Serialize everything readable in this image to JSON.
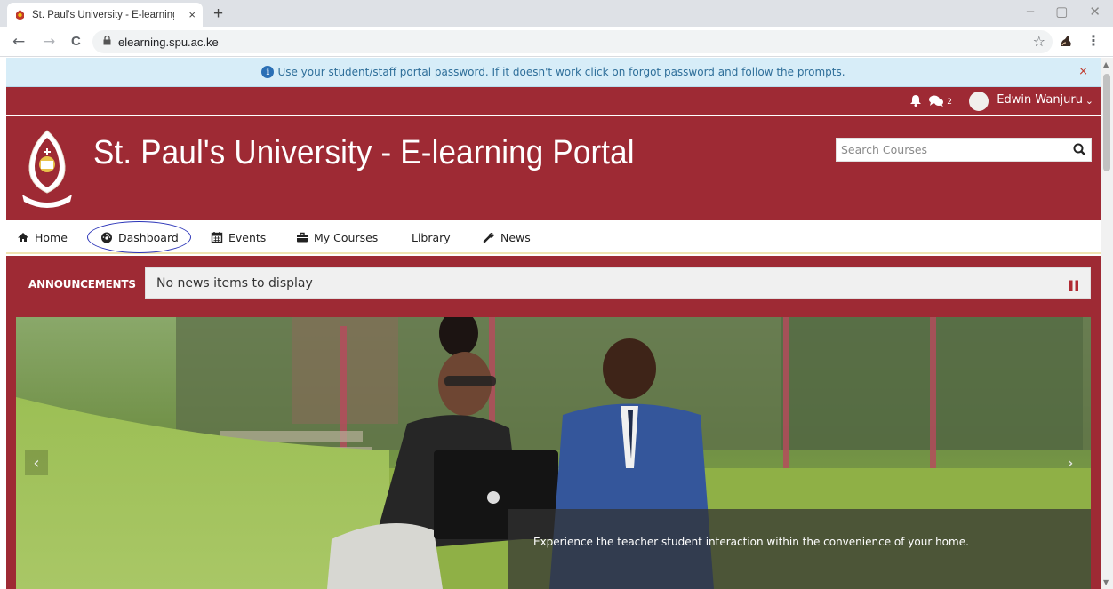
{
  "browser": {
    "tab_title": "St. Paul's University - E-learning P",
    "tab_close": "×",
    "new_tab": "+",
    "url": "elearning.spu.ac.ke",
    "back": "←",
    "forward": "→",
    "reload": "C",
    "minimize": "–",
    "restore": "▢",
    "close": "✕"
  },
  "alert": {
    "text": "Use your student/staff portal password. If it doesn't work click on forgot password and follow the prompts.",
    "close": "×"
  },
  "topbar": {
    "messages_count": "2",
    "user_name": "Edwin Wanjuru"
  },
  "header": {
    "site_title": "St. Paul's University - E-learning Portal",
    "search_placeholder": "Search Courses"
  },
  "nav": {
    "items": [
      {
        "label": "Home",
        "icon": "home-icon"
      },
      {
        "label": "Dashboard",
        "icon": "dashboard-icon"
      },
      {
        "label": "Events",
        "icon": "calendar-icon"
      },
      {
        "label": "My Courses",
        "icon": "briefcase-icon"
      },
      {
        "label": "Library",
        "icon": ""
      },
      {
        "label": "News",
        "icon": "wrench-icon"
      }
    ]
  },
  "announcements": {
    "label": "ANNOUNCEMENTS",
    "text": "No news items to display"
  },
  "slider": {
    "caption": "Experience the teacher student interaction within the convenience of your home.",
    "prev": "‹",
    "next": "›"
  },
  "colors": {
    "brand": "#9e2a34",
    "alert_bg": "#d7edf8",
    "alert_text": "#2f6f9a",
    "annotation": "#2b34b8"
  }
}
